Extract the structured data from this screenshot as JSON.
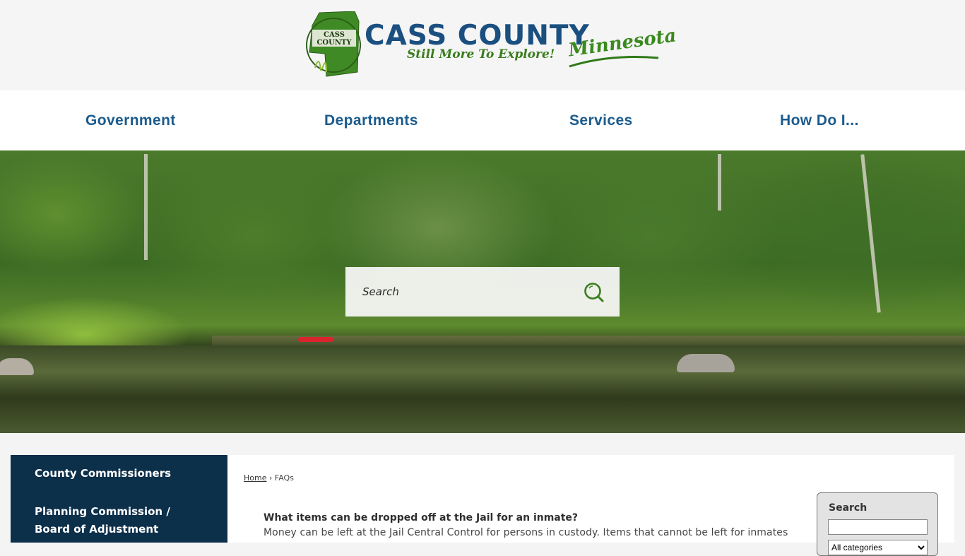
{
  "header": {
    "brand_title": "CASS COUNTY",
    "brand_tagline": "Still More To Explore!",
    "brand_state": "Minnesota",
    "seal_text": "CASS COUNTY"
  },
  "nav": {
    "items": [
      {
        "label": "Government"
      },
      {
        "label": "Departments"
      },
      {
        "label": "Services"
      },
      {
        "label": "How Do I..."
      }
    ]
  },
  "hero": {
    "search_placeholder": "Search",
    "search_icon": "search-icon"
  },
  "sidebar": {
    "items": [
      {
        "label": "County Commissioners"
      },
      {
        "label": "Planning Commission / Board of Adjustment"
      }
    ]
  },
  "breadcrumb": {
    "home": "Home",
    "separator": "›",
    "current": "FAQs"
  },
  "faq": {
    "question": "What items can be dropped off at the Jail for an inmate?",
    "answer": "Money can be left at the Jail Central Control for persons in custody. Items that cannot be left for inmates"
  },
  "search_widget": {
    "title": "Search",
    "input_value": "",
    "category_selected": "All categories"
  },
  "colors": {
    "nav_text": "#1b5b8c",
    "brand_blue": "#1a4f80",
    "brand_green": "#3a7d1e",
    "sidebar_bg": "#0c2f4a"
  }
}
